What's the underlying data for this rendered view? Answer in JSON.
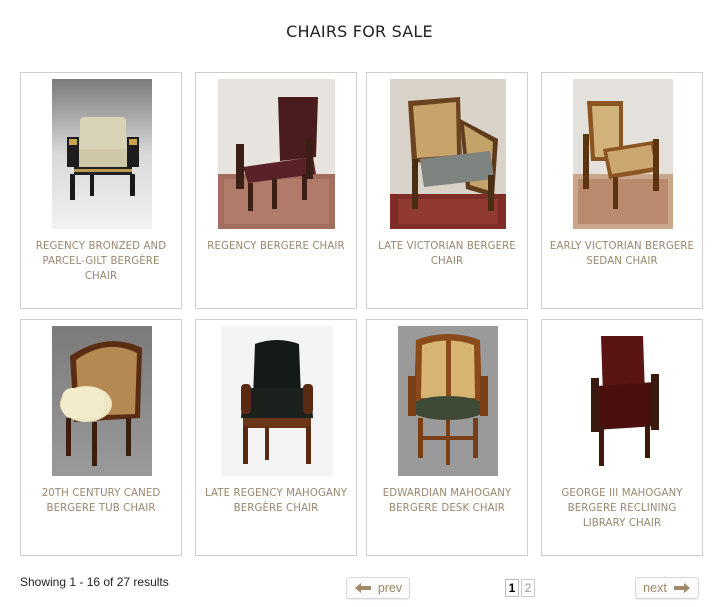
{
  "page": {
    "title": "CHAIRS FOR SALE"
  },
  "products": [
    {
      "name": "REGENCY BRONZED AND PARCEL-GILT BERGÈRE CHAIR"
    },
    {
      "name": "REGENCY BERGERE CHAIR"
    },
    {
      "name": "LATE VICTORIAN BERGERE CHAIR"
    },
    {
      "name": "EARLY VICTORIAN BERGERE SEDAN CHAIR"
    },
    {
      "name": "20TH CENTURY CANED BERGERE TUB CHAIR"
    },
    {
      "name": "LATE REGENCY MAHOGANY BERGÈRE CHAIR"
    },
    {
      "name": "EDWARDIAN MAHOGANY BERGERE DESK CHAIR"
    },
    {
      "name": "GEORGE III MAHOGANY BERGERE RECLINING LIBRARY CHAIR"
    }
  ],
  "pagination": {
    "results_text": "Showing 1 - 16 of 27 results",
    "prev_label": "prev",
    "next_label": "next",
    "pages": [
      "1",
      "2"
    ],
    "current_page": "1"
  },
  "colors": {
    "caption": "#9a8770",
    "border": "#cfcfcf",
    "arrow": "#a08a6a"
  }
}
